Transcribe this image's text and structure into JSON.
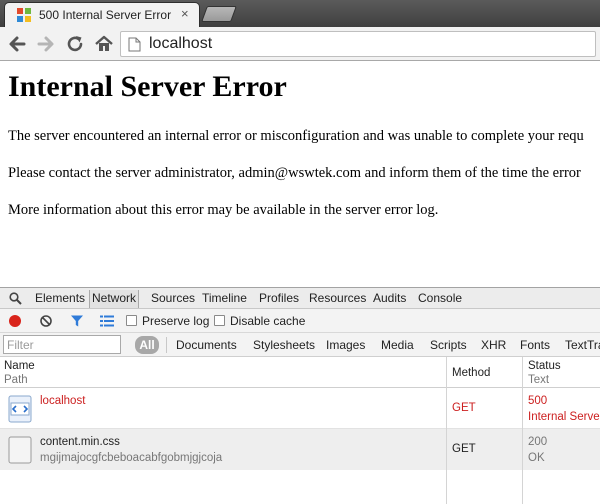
{
  "browser": {
    "tab": {
      "title": "500 Internal Server Error",
      "close": "×",
      "favicon": "windows-style-favicon-icon"
    },
    "address": "localhost"
  },
  "page": {
    "heading": "Internal Server Error",
    "paragraphs": [
      "The server encountered an internal error or misconfiguration and was unable to complete your requ",
      "Please contact the server administrator, admin@wswtek.com and inform them of the time the error",
      "More information about this error may be available in the server error log."
    ]
  },
  "devtools": {
    "tabs": [
      "Elements",
      "Network",
      "Sources",
      "Timeline",
      "Profiles",
      "Resources",
      "Audits",
      "Console"
    ],
    "active_tab": "Network",
    "options": {
      "preserve_log": "Preserve log",
      "disable_cache": "Disable cache"
    },
    "filter_placeholder": "Filter",
    "types": [
      "All",
      "Documents",
      "Stylesheets",
      "Images",
      "Media",
      "Scripts",
      "XHR",
      "Fonts",
      "TextTra"
    ],
    "columns": {
      "name": "Name",
      "path": "Path",
      "method": "Method",
      "status": "Status",
      "text": "Text"
    },
    "requests": [
      {
        "name": "localhost",
        "path": "",
        "method": "GET",
        "status": "500",
        "status_text": "Internal Serve"
      },
      {
        "name": "content.min.css",
        "path": "mgijmajocgfcbeboacabfgobmjgjcoja",
        "method": "GET",
        "status": "200",
        "status_text": "OK"
      }
    ]
  },
  "colors": {
    "error": "#cc1f1f",
    "record": "#d9241b",
    "filter_icon": "#2f7bd8"
  }
}
